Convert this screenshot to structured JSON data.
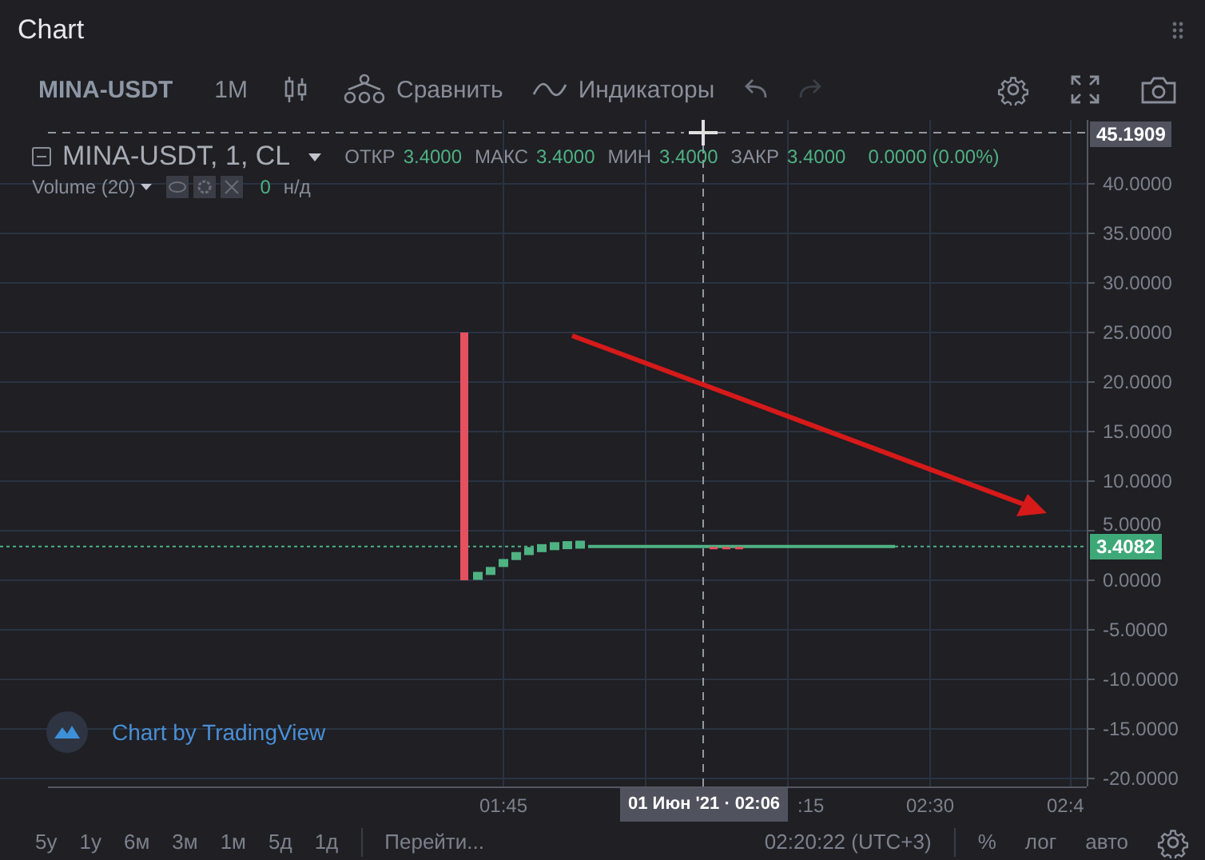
{
  "window": {
    "title": "Chart"
  },
  "toolbar": [
    {
      "kind": "symbol",
      "label": "MINA-USDT"
    },
    {
      "kind": "interval",
      "label": "1M"
    },
    {
      "kind": "chart-type"
    },
    {
      "kind": "compare",
      "label": "Сравнить"
    },
    {
      "kind": "indicators",
      "label": "Индикаторы"
    },
    {
      "kind": "undo",
      "disabled": false
    },
    {
      "kind": "redo",
      "disabled": true
    },
    {
      "kind": "settings"
    },
    {
      "kind": "fullscreen"
    },
    {
      "kind": "snapshot"
    }
  ],
  "legend": {
    "title": "MINA-USDT, 1, CL",
    "values": [
      {
        "label": "ОТКР",
        "value": "3.4000"
      },
      {
        "label": "МАКС",
        "value": "3.4000"
      },
      {
        "label": "МИН",
        "value": "3.4000"
      },
      {
        "label": "ЗАКР",
        "value": "3.4000"
      }
    ],
    "change": "0.0000 (0.00%)",
    "study": {
      "name": "Volume (20)",
      "value": "0",
      "status": "н/д"
    }
  },
  "price_axis": {
    "crosshair_price": "45.1909",
    "last_price": "3.4082",
    "ticks": [
      "40.0000",
      "35.0000",
      "30.0000",
      "25.0000",
      "20.0000",
      "15.0000",
      "10.0000",
      "5.0000",
      "0.0000",
      "-5.0000",
      "-10.0000",
      "-15.0000",
      "-20.0000"
    ]
  },
  "time_axis": {
    "labels": [
      "01:45",
      ":15",
      "02:30",
      "02:4"
    ],
    "crosshair_time": "01 Июн '21 · 02:06"
  },
  "branding": "Chart by TradingView",
  "bottom_bar": {
    "ranges": [
      "5y",
      "1y",
      "6м",
      "3м",
      "1м",
      "5д",
      "1д"
    ],
    "goto": "Перейти...",
    "clock": "02:20:22 (UTC+3)",
    "options": [
      {
        "kind": "text",
        "label": "%"
      },
      {
        "kind": "text",
        "label": "лог"
      },
      {
        "kind": "text",
        "label": "авто"
      },
      {
        "kind": "settings"
      }
    ]
  }
}
